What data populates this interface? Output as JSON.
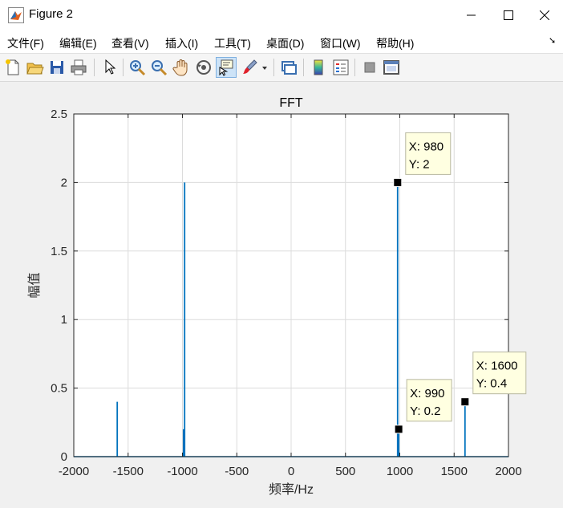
{
  "window": {
    "title": "Figure 2"
  },
  "menu": {
    "items": [
      "文件(F)",
      "编辑(E)",
      "查看(V)",
      "插入(I)",
      "工具(T)",
      "桌面(D)",
      "窗口(W)",
      "帮助(H)"
    ]
  },
  "toolbar": {
    "icons": [
      "new-figure-icon",
      "open-file-icon",
      "save-icon",
      "print-icon",
      "pointer-icon",
      "zoom-in-icon",
      "zoom-out-icon",
      "pan-hand-icon",
      "rotate-3d-icon",
      "data-cursor-icon",
      "brush-icon",
      "brush-dropdown-icon",
      "link-plot-icon",
      "colorbar-icon",
      "legend-icon",
      "hide-plot-tools-icon",
      "show-plot-tools-icon"
    ]
  },
  "colors": {
    "line": "#0072bd",
    "marker": "#000000",
    "datatip_bg": "#ffffe1"
  },
  "chart_data": {
    "type": "line",
    "title": "FFT",
    "xlabel": "频率/Hz",
    "ylabel": "幅值",
    "xlim": [
      -2000,
      2000
    ],
    "ylim": [
      0,
      2.5
    ],
    "xticks": [
      -2000,
      -1500,
      -1000,
      -500,
      0,
      500,
      1000,
      1500,
      2000
    ],
    "yticks": [
      0,
      0.5,
      1,
      1.5,
      2,
      2.5
    ],
    "xtick_labels": [
      "-2000",
      "-1500",
      "-1000",
      "-500",
      "0",
      "500",
      "1000",
      "1500",
      "2000"
    ],
    "ytick_labels": [
      "0",
      "0.5",
      "1",
      "1.5",
      "2",
      "2.5"
    ],
    "grid": true,
    "peaks": [
      {
        "x": -1600,
        "y": 0.4
      },
      {
        "x": -990,
        "y": 0.2
      },
      {
        "x": -980,
        "y": 2
      },
      {
        "x": 980,
        "y": 2
      },
      {
        "x": 990,
        "y": 0.2
      },
      {
        "x": 1600,
        "y": 0.4
      }
    ],
    "datatips": [
      {
        "x": 980,
        "y": 2,
        "label_x": "X: 980",
        "label_y": "Y: 2",
        "box_position": "above-right"
      },
      {
        "x": 990,
        "y": 0.2,
        "label_x": "X: 990",
        "label_y": "Y: 0.2",
        "box_position": "above-right"
      },
      {
        "x": 1600,
        "y": 0.4,
        "label_x": "X: 1600",
        "label_y": "Y: 0.4",
        "box_position": "above-right"
      }
    ]
  }
}
